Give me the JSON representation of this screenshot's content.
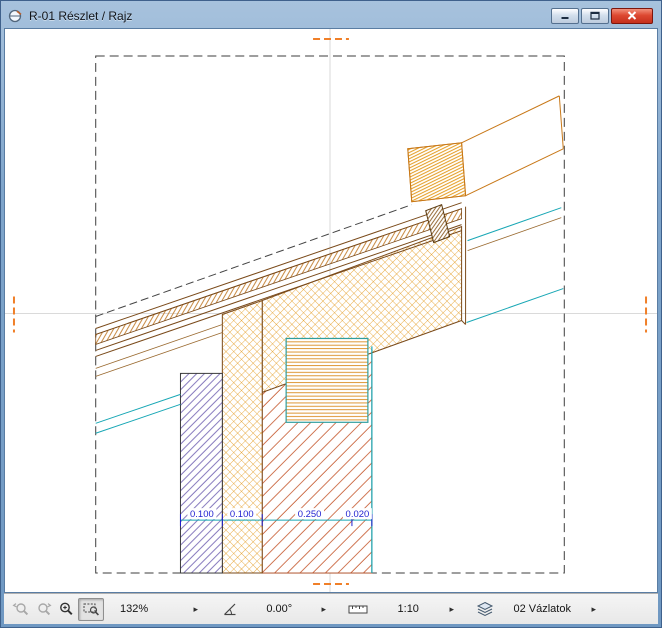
{
  "window": {
    "title": "R-01 Részlet / Rajz"
  },
  "statusbar": {
    "zoom_level": "132%",
    "rotation": "0.00°",
    "scale": "1:10",
    "layer": "02 Vázlatok"
  },
  "icons": {
    "expand_arrow": "▸"
  },
  "drawing": {
    "type": "architectural-detail-section",
    "dimension_labels": [
      "0.100",
      "0.100",
      "0.250",
      "0.020"
    ],
    "colors": {
      "insulation_crosshatch": "#e2940f",
      "roof_layer_lines": "#7a4a1a",
      "wall_hatch": "#c4552a",
      "column_hatch": "#7668b5",
      "beam_hatch": "#d98b1e",
      "reference_line": "#18a7b5",
      "dimension_text": "#1f1fd0",
      "center_marker": "#f07f28",
      "boundary_line": "#3d3d3d"
    }
  }
}
